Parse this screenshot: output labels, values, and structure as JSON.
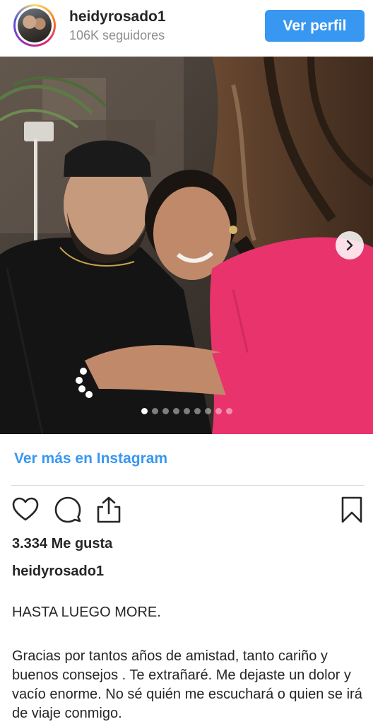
{
  "header": {
    "username": "heidyrosado1",
    "followers": "106K seguidores",
    "view_profile_label": "Ver perfil"
  },
  "carousel": {
    "total_images": 9,
    "active_index": 0
  },
  "see_more_link": "Ver más en Instagram",
  "actions": {
    "like_icon": "heart-icon",
    "comment_icon": "comment-icon",
    "share_icon": "share-icon",
    "save_icon": "bookmark-icon"
  },
  "likes_text": "3.334 Me gusta",
  "caption": {
    "username": "heidyrosado1",
    "title": "HASTA LUEGO MORE.",
    "body": "Gracias por tantos años de amistad, tanto cariño y buenos consejos . Te extrañaré. Me dejaste un dolor y vacío enorme. No sé quién me escuchará o quien se irá de viaje conmigo."
  },
  "colors": {
    "accent": "#3897f0",
    "text": "#262626",
    "muted": "#8e8e8e",
    "divider": "#dbdbdb"
  }
}
